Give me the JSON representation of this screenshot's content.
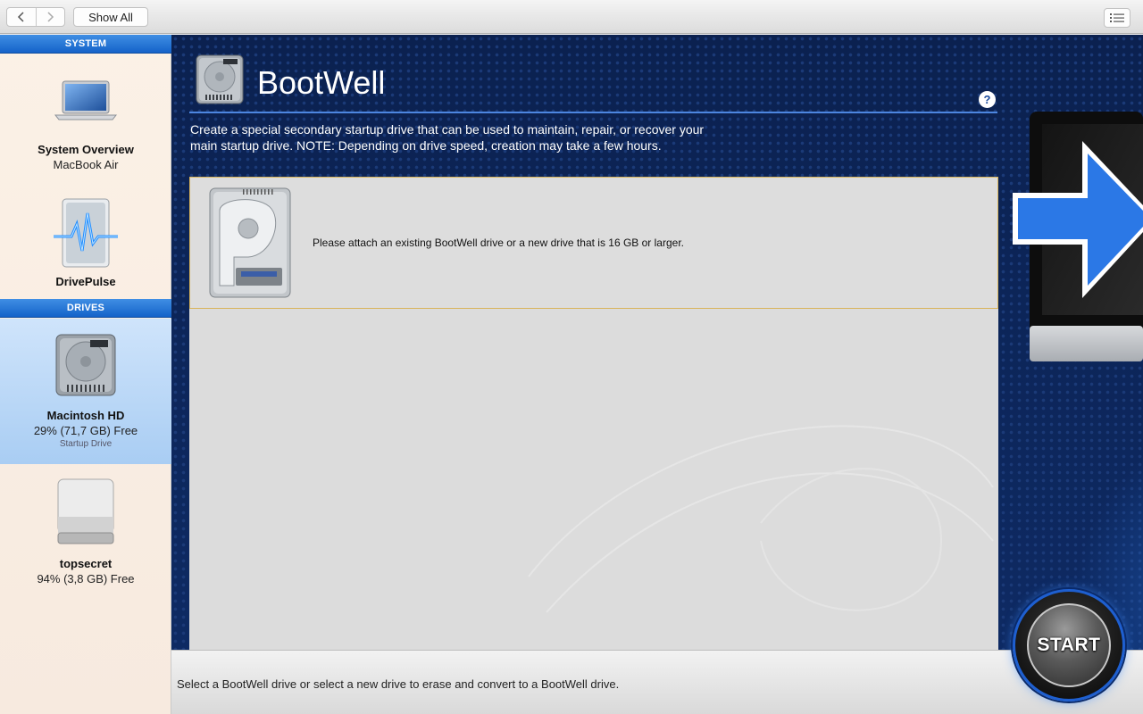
{
  "toolbar": {
    "back_icon": "chevron-left-icon",
    "forward_icon": "chevron-right-icon",
    "show_all_label": "Show All",
    "list_icon": "list-view-icon"
  },
  "sidebar": {
    "system_header": "SYSTEM",
    "drives_header": "DRIVES",
    "system_items": [
      {
        "title": "System Overview",
        "subtitle": "MacBook Air",
        "icon": "laptop-icon"
      },
      {
        "title": "DrivePulse",
        "icon": "drivepulse-icon"
      }
    ],
    "drive_items": [
      {
        "title": "Macintosh HD",
        "subtitle": "29% (71,7 GB) Free",
        "note": "Startup Drive",
        "icon": "hard-drive-icon",
        "selected": true
      },
      {
        "title": "topsecret",
        "subtitle": "94% (3,8 GB) Free",
        "icon": "external-drive-icon"
      }
    ]
  },
  "main": {
    "title": "BootWell",
    "help_label": "?",
    "description": "Create a special secondary startup drive that can be used to maintain, repair, or recover your main startup drive. NOTE: Depending on drive speed, creation may take a few hours.",
    "attach_message": "Please attach an existing BootWell drive or a new drive that is 16 GB or larger."
  },
  "status": {
    "message": "Select a BootWell drive or select a new drive to erase and convert to a BootWell drive."
  },
  "start_button": {
    "label": "START"
  },
  "colors": {
    "accent_blue": "#1563c9",
    "main_background": "#0e2a63",
    "selected_row": "#a9cdf3",
    "drop_border": "#d8b45a"
  }
}
